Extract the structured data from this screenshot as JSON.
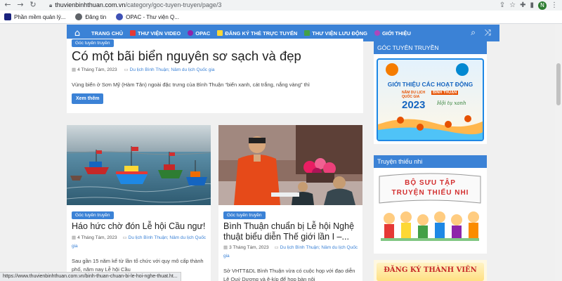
{
  "browser": {
    "url_host": "thuvienbinhthuan.com.vn",
    "url_path": "/category/goc-tuyen-truyen/page/3",
    "profile_initial": "N"
  },
  "bookmarks": [
    {
      "label": "Phần mềm quản lý...",
      "color": "#1a237e"
    },
    {
      "label": "Đăng tin",
      "color": "#5f6368"
    },
    {
      "label": "OPAC - Thư viện Q...",
      "color": "#3f51b5"
    }
  ],
  "nav": {
    "items": [
      {
        "label": "TRANG CHỦ",
        "color": "#3b82d6"
      },
      {
        "label": "THƯ VIỆN VIDEO",
        "color": "#e53935"
      },
      {
        "label": "OPAC",
        "color": "#8e24aa"
      },
      {
        "label": "ĐĂNG KÝ THẺ TRỰC TUYẾN",
        "color": "#fdd835"
      },
      {
        "label": "THƯ VIỆN LƯU ĐỘNG",
        "color": "#43a047"
      },
      {
        "label": "GIỚI THIỆU",
        "color": "#ab47bc"
      }
    ]
  },
  "featured": {
    "tag": "Góc tuyên truyền",
    "title": "Có một bãi biển nguyên sơ sạch và đẹp",
    "date": "4 Tháng Tám, 2023",
    "categories": "Du lịch Bình Thuận; Nâm du lịch Quốc gia",
    "excerpt": "Vùng biển ở Sơn Mỹ (Hàm Tân) ngoài đặc trưng của Bình Thuận “biển xanh, cát trắng, nắng vàng” thì",
    "button": "Xem thêm"
  },
  "posts": [
    {
      "tag": "Góc tuyên truyền",
      "title": "Háo hức chờ đón Lễ hội Cầu ngư!",
      "date": "4 Tháng Tám, 2023",
      "categories": "Du lịch Bình Thuận; Nâm du lịch Quốc gia",
      "excerpt": "Sau gần 15 năm kể từ lần tổ chức với quy mô cấp thành phố, năm nay Lễ hội Cầu"
    },
    {
      "tag": "Góc tuyên truyền",
      "title": "Bình Thuận chuẩn bị Lễ hội Nghệ thuật biểu diễn Thế giới lần I –...",
      "date": "3 Tháng Tám, 2023",
      "categories": "Du lịch Bình Thuận; Nâm du lịch Quốc gia",
      "excerpt": "Sở VHTT&DL Bình Thuận vừa có cuộc họp với đạo diễn Lê Quý Dương và ê-kíp để họp bàn nội"
    }
  ],
  "sidebar": {
    "widget1_title": "GÓC TUYÊN TRUYỀN",
    "banner": {
      "headline": "GIỚI THIỆU CÁC HOẠT ĐỘNG",
      "sub1": "NĂM DU LỊCH",
      "sub2": "QUỐC GIA",
      "place": "BÌNH THUẬN",
      "year": "2023",
      "slogan": "Hội tụ xanh"
    },
    "widget2_title": "Truyện thiếu nhi",
    "kids": {
      "line1": "BỘ SƯU TẬP",
      "line2": "TRUYỆN THIẾU NHI"
    },
    "widget3_text": "ĐĂNG KÝ THÀNH VIÊN"
  },
  "status_url": "https://www.thuvienbinhthuan.com.vn/binh-thuan-chuan-bi-le-hoi-nghe-thuat.ht..."
}
